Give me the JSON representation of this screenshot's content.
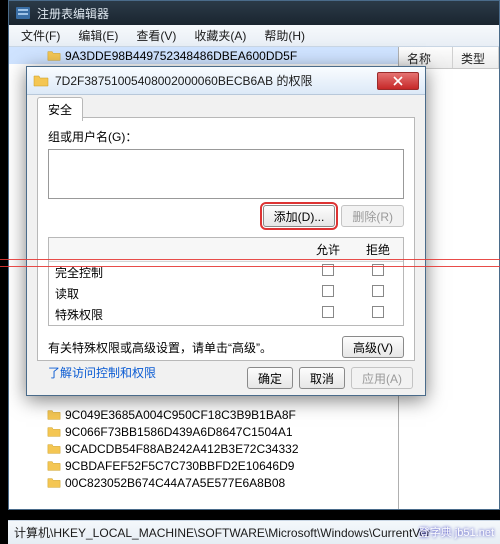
{
  "regedit": {
    "title": "注册表编辑器",
    "menu": {
      "file": "文件(F)",
      "edit": "编辑(E)",
      "view": "查看(V)",
      "fav": "收藏夹(A)",
      "help": "帮助(H)"
    },
    "list_headers": {
      "name": "名称",
      "type": "类型"
    },
    "tree_items": [
      "9A3DDE98B449752348486DBEA600DD5F",
      "9C049E3685A004C950CF18C3B9B1BA8F",
      "9C066F73BB1586D439A6D8647C1504A1",
      "9CADCDB54F88AB242A412B3E72C34332",
      "9CBDAFEF52F5C7C730BBFD2E10646D9",
      "00C823052B674C44A7A5E577E6A8B08"
    ],
    "selected_index": 0,
    "status": "计算机\\HKEY_LOCAL_MACHINE\\SOFTWARE\\Microsoft\\Windows\\CurrentVer"
  },
  "perm": {
    "title": "7D2F38751005408002000060BECB6AB 的权限",
    "tab": "安全",
    "group_label": "组或用户名(G)：",
    "add": "添加(D)...",
    "remove": "删除(R)",
    "col_allow": "允许",
    "col_deny": "拒绝",
    "perms": [
      {
        "name": "完全控制"
      },
      {
        "name": "读取"
      },
      {
        "name": "特殊权限"
      }
    ],
    "adv_text": "有关特殊权限或高级设置，请单击“高级”。",
    "adv_btn": "高级(V)",
    "link": "了解访问控制和权限",
    "ok": "确定",
    "cancel": "取消",
    "apply": "应用(A)"
  },
  "watermark": "登字典  jb51.net"
}
